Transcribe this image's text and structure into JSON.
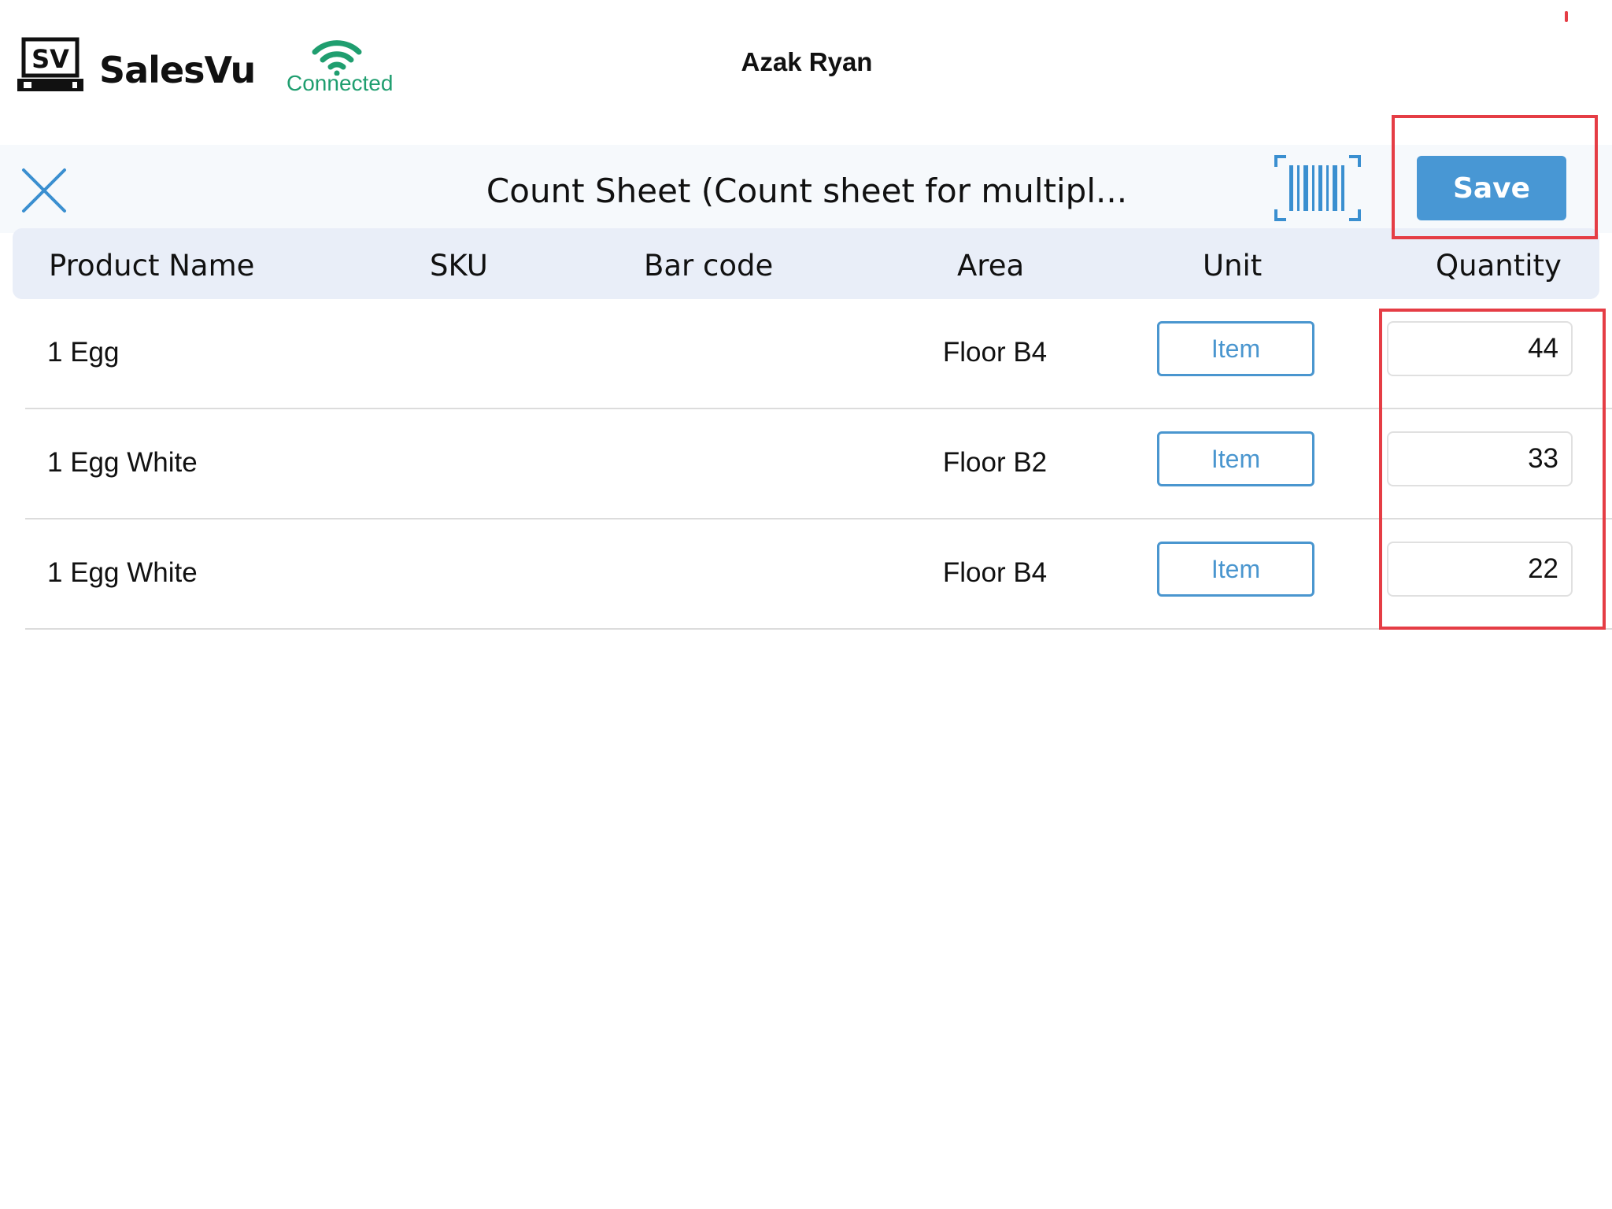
{
  "app": {
    "brand": "SalesVu",
    "logo_text": "SV",
    "connection_status": "Connected",
    "user_name": "Azak Ryan"
  },
  "header": {
    "title": "Count Sheet (Count sheet for multipl...",
    "save_label": "Save",
    "close_icon": "close-icon",
    "barcode_icon": "barcode-scan-icon"
  },
  "table": {
    "columns": [
      "Product Name",
      "SKU",
      "Bar code",
      "Area",
      "Unit",
      "Quantity"
    ],
    "rows": [
      {
        "product_name": "1 Egg",
        "sku": "",
        "bar_code": "",
        "area": "Floor B4",
        "unit": "Item",
        "quantity": "44"
      },
      {
        "product_name": "1 Egg White",
        "sku": "",
        "bar_code": "",
        "area": "Floor B2",
        "unit": "Item",
        "quantity": "33"
      },
      {
        "product_name": "1 Egg White",
        "sku": "",
        "bar_code": "",
        "area": "Floor B4",
        "unit": "Item",
        "quantity": "22"
      }
    ]
  },
  "colors": {
    "accent": "#4897d4",
    "connected": "#1f9e6f",
    "highlight": "#e53d45",
    "header_band": "#f6f9fc",
    "table_header": "#e9eef8"
  }
}
